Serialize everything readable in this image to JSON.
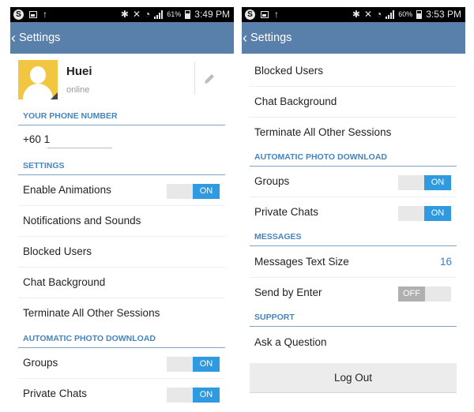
{
  "left": {
    "status": {
      "battery": "61%",
      "time": "3:49 PM"
    },
    "header": {
      "title": "Settings"
    },
    "profile": {
      "name": "Huei",
      "status": "online"
    },
    "phone_section": {
      "title": "YOUR PHONE NUMBER",
      "value": "+60 1"
    },
    "settings_section": {
      "title": "SETTINGS"
    },
    "items": [
      {
        "label": "Enable Animations",
        "toggle": "ON"
      },
      {
        "label": "Notifications and Sounds"
      },
      {
        "label": "Blocked Users"
      },
      {
        "label": "Chat Background"
      },
      {
        "label": "Terminate All Other Sessions"
      }
    ],
    "auto_section": {
      "title": "AUTOMATIC PHOTO DOWNLOAD"
    },
    "auto_items": [
      {
        "label": "Groups",
        "toggle": "ON"
      },
      {
        "label": "Private Chats",
        "toggle": "ON"
      }
    ]
  },
  "right": {
    "status": {
      "battery": "60%",
      "time": "3:53 PM"
    },
    "header": {
      "title": "Settings"
    },
    "items": [
      {
        "label": "Blocked Users"
      },
      {
        "label": "Chat Background"
      },
      {
        "label": "Terminate All Other Sessions"
      }
    ],
    "auto_section": {
      "title": "AUTOMATIC PHOTO DOWNLOAD"
    },
    "auto_items": [
      {
        "label": "Groups",
        "toggle": "ON"
      },
      {
        "label": "Private Chats",
        "toggle": "ON"
      }
    ],
    "messages_section": {
      "title": "MESSAGES"
    },
    "messages_items": [
      {
        "label": "Messages Text Size",
        "value": "16"
      },
      {
        "label": "Send by Enter",
        "toggle": "OFF"
      }
    ],
    "support_section": {
      "title": "SUPPORT"
    },
    "support_items": [
      {
        "label": "Ask a Question"
      }
    ],
    "logout_label": "Log Out"
  },
  "icons": {
    "status_left": [
      "s-app-icon",
      "image-icon",
      "upload-icon"
    ],
    "status_right": [
      "bluetooth-icon",
      "mute-icon",
      "wifi-icon",
      "signal-icon",
      "battery-icon"
    ],
    "back": "back-chevron-icon",
    "edit": "pencil-icon"
  },
  "colors": {
    "action_bar": "#5880aa",
    "section_text": "#4684bd",
    "toggle_on": "#2f9ae0",
    "toggle_off": "#b0b0b0",
    "avatar": "#f2c641",
    "value_text": "#3a7fc0"
  }
}
